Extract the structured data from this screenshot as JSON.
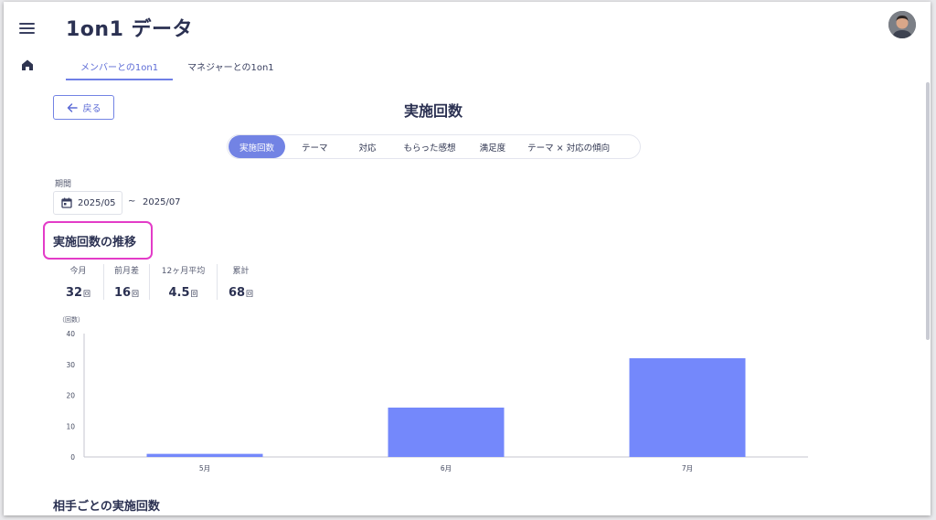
{
  "app": {
    "title": "1on1 データ"
  },
  "nav": {
    "menu_icon": "hamburger-icon",
    "home_icon": "home-icon"
  },
  "tabs": [
    {
      "label": "メンバーとの1on1",
      "active": true
    },
    {
      "label": "マネジャーとの1on1",
      "active": false
    }
  ],
  "back_button": {
    "label": "戻る"
  },
  "page": {
    "title": "実施回数"
  },
  "segments": [
    {
      "label": "実施回数",
      "active": true
    },
    {
      "label": "テーマ",
      "active": false
    },
    {
      "label": "対応",
      "active": false
    },
    {
      "label": "もらった感想",
      "active": false
    },
    {
      "label": "満足度",
      "active": false
    },
    {
      "label": "テーマ × 対応の傾向",
      "active": false
    }
  ],
  "period": {
    "label": "期間",
    "start": "2025/05",
    "separator": "~",
    "end": "2025/07"
  },
  "section": {
    "title": "実施回数の推移"
  },
  "stats": [
    {
      "label": "今月",
      "value": "32",
      "unit": "回"
    },
    {
      "label": "前月差",
      "value": "16",
      "unit": "回"
    },
    {
      "label": "12ヶ月平均",
      "value": "4.5",
      "unit": "回"
    },
    {
      "label": "累計",
      "value": "68",
      "unit": "回"
    }
  ],
  "chart_data": {
    "type": "bar",
    "categories": [
      "5月",
      "6月",
      "7月"
    ],
    "values": [
      1,
      16,
      32
    ],
    "ylabel": "（回数）",
    "ylim": [
      0,
      40
    ],
    "yticks": [
      0,
      10,
      20,
      30,
      40
    ],
    "grid": false,
    "bar_color": "#7488fb"
  },
  "next_section": {
    "title": "相手ごとの実施回数"
  },
  "colors": {
    "accent": "#7283e4",
    "highlight": "#e33cc8"
  }
}
